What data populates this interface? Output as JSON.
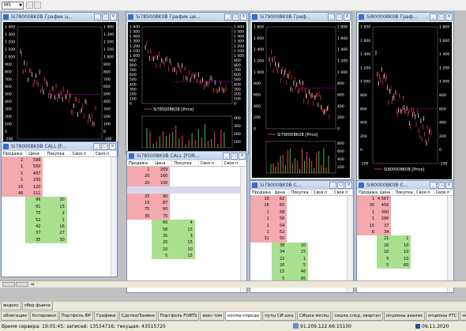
{
  "toolbar": {
    "timeframe": "M5"
  },
  "charts": [
    {
      "title": "Si78000BK0B График ц...",
      "legend": "Si78000BK0B [Price]",
      "yticks": [
        "1 400",
        "1 300",
        "1 200",
        "1 100",
        "1 000",
        "900",
        "800",
        "700",
        "600",
        "500",
        "400",
        "300",
        "200",
        "100",
        "0",
        "-100"
      ],
      "right": true
    },
    {
      "title": "Si78500BK0B График це...",
      "legend": "Si78500BK0B [Price]",
      "yticks": [
        "1 600",
        "1 500",
        "1 400",
        "1 300",
        "1 200",
        "1 100",
        "1 000",
        "900",
        "800",
        "700",
        "600",
        "500",
        "400",
        "300",
        "200",
        "100",
        "0"
      ],
      "right": true,
      "sub": [
        "400",
        "300",
        "200",
        "100"
      ]
    },
    {
      "title": "Si79000BK0B Граф...",
      "legend": "Si79000BK0B [Price]",
      "yticks": [
        "1 800",
        "1 600",
        "1 400",
        "1 200",
        "1 000",
        "800",
        "600",
        "400",
        "200",
        "0"
      ],
      "right": true,
      "sub": [
        "800",
        "600",
        "400",
        "200"
      ]
    },
    {
      "title": "Si80000BK0B Граф...",
      "legend": "Si80000BK0B [Price]",
      "yticks": [
        "1 800",
        "1 600",
        "1 400",
        "1 200",
        "1 000",
        "800",
        "600",
        "400",
        "200",
        "0",
        "-100"
      ],
      "right": true
    }
  ],
  "books": [
    {
      "title": "Si78000BK0B CALL [F...",
      "headers": [
        "Продажа",
        "Цена",
        "Покупка",
        "Своя п",
        "Своя п"
      ],
      "rows": [
        {
          "t": "sell",
          "v": [
            "2",
            "599",
            "",
            "",
            ""
          ]
        },
        {
          "t": "sell",
          "v": [
            "1",
            "550",
            "",
            "",
            ""
          ]
        },
        {
          "t": "sell",
          "v": [
            "1",
            "497",
            "",
            "",
            ""
          ]
        },
        {
          "t": "sell",
          "v": [
            "1",
            "230",
            "",
            "",
            ""
          ]
        },
        {
          "t": "sell",
          "v": [
            "15",
            "120",
            "",
            "",
            ""
          ]
        },
        {
          "t": "sell",
          "v": [
            "40",
            "111",
            "",
            "",
            ""
          ]
        },
        {
          "t": "buy",
          "v": [
            "",
            "96",
            "30",
            "",
            ""
          ]
        },
        {
          "t": "buy",
          "v": [
            "",
            "91",
            "15",
            "",
            ""
          ]
        },
        {
          "t": "buy",
          "v": [
            "",
            "75",
            "2",
            "",
            ""
          ]
        },
        {
          "t": "buy",
          "v": [
            "",
            "52",
            "1",
            "",
            ""
          ]
        },
        {
          "t": "buy",
          "v": [
            "",
            "42",
            "16",
            "",
            ""
          ]
        },
        {
          "t": "buy",
          "v": [
            "",
            "37",
            "27",
            "",
            ""
          ]
        },
        {
          "t": "buy",
          "v": [
            "",
            "35",
            "30",
            "",
            ""
          ]
        }
      ]
    },
    {
      "title": "Si78500BK0B CALL [FOR...",
      "headers": [
        "Продажа",
        "Цена",
        "Покупка",
        "Своя п",
        "Своя п"
      ],
      "rows": [
        {
          "t": "sell",
          "v": [
            "1",
            "269",
            "",
            "",
            ""
          ]
        },
        {
          "t": "sell",
          "v": [
            "20",
            "160",
            "",
            "",
            ""
          ]
        },
        {
          "t": "sell",
          "v": [
            "20",
            "100",
            "",
            "",
            ""
          ]
        },
        {
          "t": "sel",
          "v": [
            "",
            "",
            "",
            "",
            ""
          ]
        },
        {
          "t": "sell",
          "v": [
            "25",
            "90",
            "",
            "",
            ""
          ]
        },
        {
          "t": "sell",
          "v": [
            "15",
            "87",
            "",
            "",
            ""
          ]
        },
        {
          "t": "sell",
          "v": [
            "75",
            "80",
            "",
            "",
            ""
          ]
        },
        {
          "t": "sell",
          "v": [
            "30",
            "75",
            "",
            "",
            ""
          ]
        },
        {
          "t": "buy",
          "v": [
            "",
            "60",
            "4",
            "",
            ""
          ]
        },
        {
          "t": "buy",
          "v": [
            "",
            "58",
            "15",
            "",
            ""
          ]
        },
        {
          "t": "buy",
          "v": [
            "",
            "35",
            "3",
            "",
            ""
          ]
        },
        {
          "t": "buy",
          "v": [
            "",
            "20",
            "15",
            "",
            ""
          ]
        },
        {
          "t": "buy",
          "v": [
            "",
            "10",
            "10",
            "",
            ""
          ]
        },
        {
          "t": "buy",
          "v": [
            "",
            "5",
            "15",
            "",
            ""
          ]
        }
      ]
    },
    {
      "title": "Si79000BK0B C...",
      "headers": [
        "Продажа",
        "Цена",
        "Покупка",
        "Своя п",
        "Своя п"
      ],
      "rows": [
        {
          "t": "sell",
          "v": [
            "16",
            "62",
            "",
            "",
            ""
          ]
        },
        {
          "t": "sell",
          "v": [
            "26",
            "60",
            "",
            "",
            ""
          ]
        },
        {
          "t": "sell",
          "v": [
            "1",
            "58",
            "",
            "",
            ""
          ]
        },
        {
          "t": "sell",
          "v": [
            "1",
            "56",
            "",
            "",
            ""
          ]
        },
        {
          "t": "sell",
          "v": [
            "1",
            "54",
            "",
            "",
            ""
          ]
        },
        {
          "t": "sell",
          "v": [
            "1",
            "52",
            "",
            "",
            ""
          ]
        },
        {
          "t": "sell",
          "v": [
            "31",
            "50",
            "",
            "",
            ""
          ]
        },
        {
          "t": "buy",
          "v": [
            "",
            "38",
            "10",
            "",
            ""
          ]
        },
        {
          "t": "buy",
          "v": [
            "",
            "34",
            "15",
            "",
            ""
          ]
        },
        {
          "t": "buy",
          "v": [
            "",
            "22",
            "1",
            "",
            ""
          ]
        },
        {
          "t": "buy",
          "v": [
            "",
            "20",
            "5",
            "",
            ""
          ]
        },
        {
          "t": "buy",
          "v": [
            "",
            "15",
            "46",
            "",
            ""
          ]
        },
        {
          "t": "buy",
          "v": [
            "",
            "5",
            "85",
            "",
            ""
          ]
        }
      ]
    },
    {
      "title": "Si80000BK0B C...",
      "headers": [
        "Продажа",
        "Цена",
        "Покупка",
        "Своя п",
        "Своя п"
      ],
      "rows": [
        {
          "t": "sell",
          "v": [
            "1",
            "4 567",
            "",
            "",
            ""
          ]
        },
        {
          "t": "sell",
          "v": [
            "30",
            "450",
            "",
            "",
            ""
          ]
        },
        {
          "t": "sell",
          "v": [
            "1",
            "300",
            "",
            "",
            ""
          ]
        },
        {
          "t": "sell",
          "v": [
            "1",
            "290",
            "",
            "",
            ""
          ]
        },
        {
          "t": "sell",
          "v": [
            "15",
            "37",
            "",
            "",
            ""
          ]
        },
        {
          "t": "sell",
          "v": [
            "6",
            "34",
            "",
            "",
            ""
          ]
        },
        {
          "t": "buy",
          "v": [
            "",
            "21",
            "1",
            "",
            ""
          ]
        },
        {
          "t": "buy",
          "v": [
            "",
            "20",
            "10",
            "",
            ""
          ]
        },
        {
          "t": "buy",
          "v": [
            "",
            "10",
            "10",
            "",
            ""
          ]
        },
        {
          "t": "buy",
          "v": [
            "",
            "5",
            "10",
            "",
            ""
          ]
        },
        {
          "t": "buy",
          "v": [
            "",
            "5",
            "60",
            "",
            ""
          ]
        }
      ]
    }
  ],
  "taskbar": {
    "label": "ш"
  },
  "tabs_row1": [
    "яндекс",
    "сбер фьючи"
  ],
  "tabs_row2": [
    "облигации",
    "Котировки",
    "Портфель ФР",
    "Графики",
    "Сделки/Заявки",
    "Портфель FORTS",
    "вакс-том",
    "коллы-спреды",
    "путы СИ-шка",
    "СИшка месяц",
    "сишка след. квартал",
    "опционы анализ",
    "опционы РТС",
    "нефть-"
  ],
  "active_tab": "коллы-спреды",
  "status": {
    "left": "Время сервера: 19:05:45; записей: 13534716; текущая: 43515720",
    "ip": "91.209.122.66:15100",
    "date": "09.11.2020"
  },
  "colors": {
    "sell": "#f4a9ae",
    "buy": "#a9e08f",
    "chart_bg": "#000000",
    "line": "#ff4040",
    "level": "#ff00ff"
  }
}
